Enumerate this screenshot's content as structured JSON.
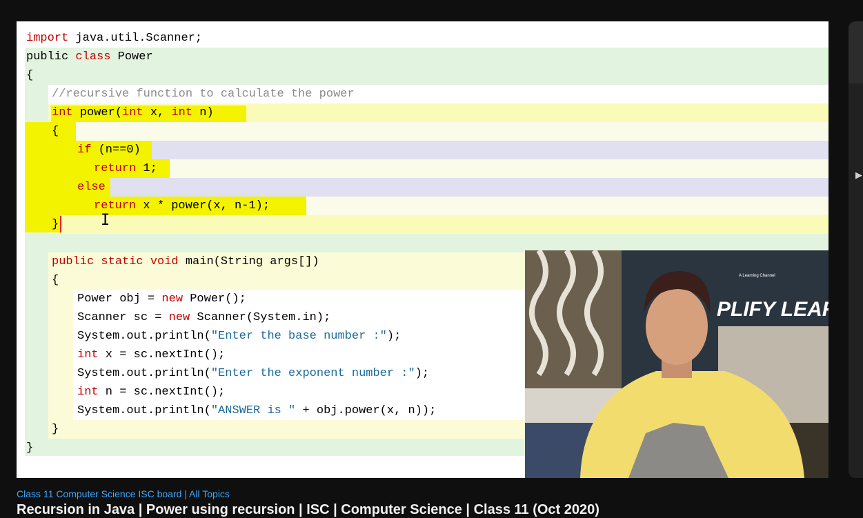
{
  "player": {
    "code_lines": [
      {
        "parts": [
          {
            "t": "import",
            "c": "kw"
          },
          {
            "t": " java.util.Scanner;"
          }
        ]
      },
      {
        "parts": [
          {
            "t": "public "
          },
          {
            "t": "class",
            "c": "kw"
          },
          {
            "t": " Power"
          }
        ]
      },
      {
        "parts": [
          {
            "t": "{"
          }
        ]
      },
      {
        "parts": [
          {
            "t": "//recursive function to calculate the power",
            "c": "cmt"
          }
        ]
      },
      {
        "parts": [
          {
            "t": "int",
            "c": "kw"
          },
          {
            "t": " power("
          },
          {
            "t": "int",
            "c": "kw"
          },
          {
            "t": " x, "
          },
          {
            "t": "int",
            "c": "kw"
          },
          {
            "t": " n)"
          }
        ]
      },
      {
        "parts": [
          {
            "t": "{"
          }
        ]
      },
      {
        "parts": [
          {
            "t": "if",
            "c": "kw"
          },
          {
            "t": " (n==0)"
          }
        ]
      },
      {
        "parts": [
          {
            "t": "return",
            "c": "kw"
          },
          {
            "t": " 1;"
          }
        ]
      },
      {
        "parts": [
          {
            "t": "else",
            "c": "kw"
          }
        ]
      },
      {
        "parts": [
          {
            "t": "return",
            "c": "kw"
          },
          {
            "t": " x * power(x, n-1);"
          }
        ]
      },
      {
        "parts": [
          {
            "t": "}"
          }
        ]
      },
      {
        "parts": [
          {
            "t": "public static void",
            "c": "kw"
          },
          {
            "t": " main(String args[])"
          }
        ]
      },
      {
        "parts": [
          {
            "t": "{"
          }
        ]
      },
      {
        "parts": [
          {
            "t": "Power obj = "
          },
          {
            "t": "new",
            "c": "kw"
          },
          {
            "t": " Power();"
          }
        ]
      },
      {
        "parts": [
          {
            "t": "Scanner sc = "
          },
          {
            "t": "new",
            "c": "kw"
          },
          {
            "t": " Scanner(System.in);"
          }
        ]
      },
      {
        "parts": [
          {
            "t": "System.out.println("
          },
          {
            "t": "\"Enter the base number :\"",
            "c": "str"
          },
          {
            "t": ");"
          }
        ]
      },
      {
        "parts": [
          {
            "t": "int",
            "c": "kw"
          },
          {
            "t": " x = sc.nextInt();"
          }
        ]
      },
      {
        "parts": [
          {
            "t": "System.out.println("
          },
          {
            "t": "\"Enter the exponent number :\"",
            "c": "str"
          },
          {
            "t": ");"
          }
        ]
      },
      {
        "parts": [
          {
            "t": "int",
            "c": "kw"
          },
          {
            "t": " n = sc.nextInt();"
          }
        ]
      },
      {
        "parts": [
          {
            "t": "System.out.println("
          },
          {
            "t": "\"ANSWER is \"",
            "c": "str"
          },
          {
            "t": " + obj.power(x, n));"
          }
        ]
      },
      {
        "parts": [
          {
            "t": "}"
          }
        ]
      },
      {
        "parts": [
          {
            "t": "}"
          }
        ]
      }
    ],
    "webcam_banner_text": "PLIFY LEARNI",
    "webcam_banner_small": "A Learning Channel"
  },
  "sidebar": {
    "arrow_icon": "play-arrow-icon"
  },
  "video": {
    "hashtags": "Class 11 Computer Science ISC board | All Topics",
    "title": "Recursion in Java | Power using recursion | ISC | Computer Science | Class 11 (Oct 2020)"
  },
  "colors": {
    "highlight": "#f3f300",
    "keyword": "#c00000",
    "link": "#3ea6ff",
    "background": "#0f0f0f"
  }
}
